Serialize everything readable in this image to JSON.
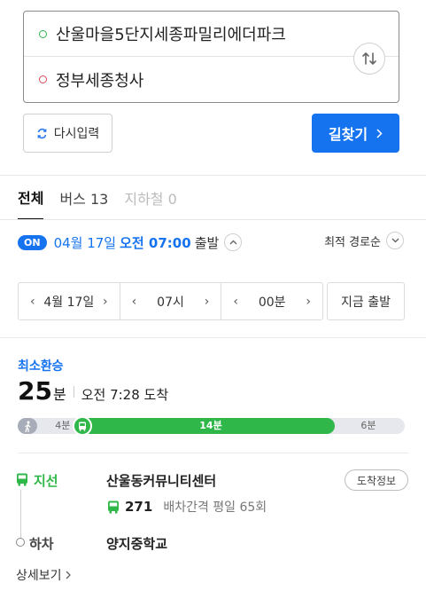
{
  "route": {
    "origin": "산울마을5단지세종파밀리에더파크",
    "destination": "정부세종청사"
  },
  "buttons": {
    "reset_label": "다시입력",
    "search_label": "길찾기"
  },
  "tabs": [
    {
      "label": "전체",
      "active": true
    },
    {
      "label": "버스 13",
      "active": false
    },
    {
      "label": "지하철 0",
      "active": false,
      "disabled": true
    }
  ],
  "departure": {
    "badge": "ON",
    "date": "04월 17일",
    "time": "오전 07:00",
    "label": "출발",
    "sort_label": "최적 경로순"
  },
  "time_picker": {
    "date": "4월 17일",
    "hour": "07시",
    "minute": "00분",
    "now_label": "지금 출발"
  },
  "result": {
    "tag": "최소환승",
    "duration_num": "25",
    "duration_unit": "분",
    "arrival": "오전 7:28 도착",
    "segments": {
      "walk1": "4분",
      "bus": "14분",
      "walk2": "6분"
    },
    "segment_minutes": {
      "walk1": 4,
      "bus": 14,
      "walk2": 6
    },
    "board": {
      "type_label": "지선",
      "stop_name": "산울동커뮤니티센터",
      "arrive_info_label": "도착정보",
      "bus_number": "271",
      "interval": "배차간격 평일 65회"
    },
    "alight": {
      "label": "하차",
      "stop_name": "양지중학교"
    },
    "detail_label": "상세보기"
  },
  "colors": {
    "accent": "#1673f0",
    "bus_green": "#2fb849",
    "origin_dot": "#2db34a",
    "dest_dot": "#d9485b"
  }
}
